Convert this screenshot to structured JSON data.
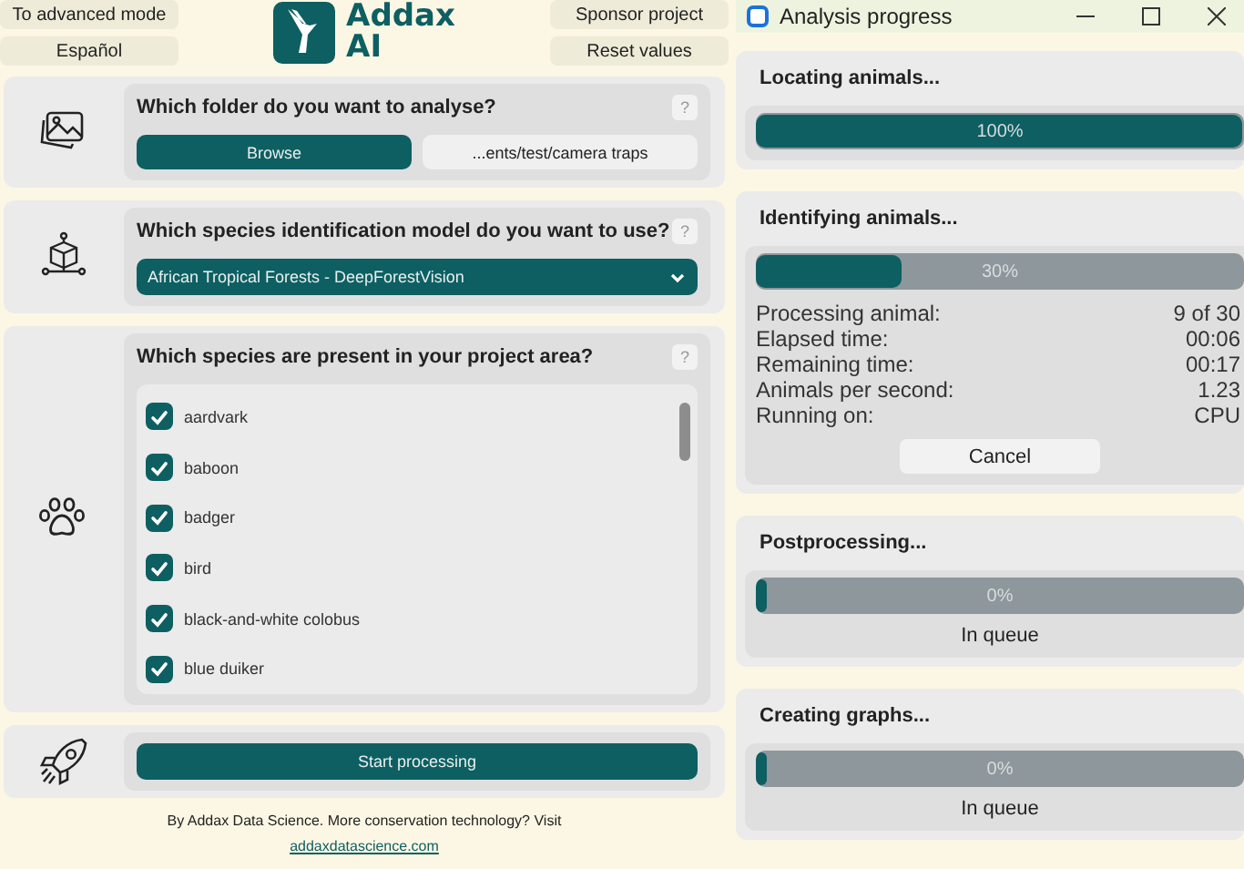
{
  "header": {
    "left_buttons": [
      "To advanced mode",
      "Español"
    ],
    "logo_text": [
      "Addax",
      "AI"
    ],
    "right_buttons": [
      "Sponsor project",
      "Reset values"
    ]
  },
  "steps": [
    {
      "kind": "folder",
      "question": "Which folder do you want to analyse?",
      "help": "?",
      "browse": "Browse",
      "path": "...ents/test/camera traps"
    },
    {
      "kind": "model",
      "question": "Which species identification model do you want to use?",
      "help": "?",
      "selected_model": "African Tropical Forests - DeepForestVision"
    },
    {
      "kind": "species",
      "question": "Which species are present in your project area?",
      "help": "?",
      "species": [
        {
          "name": "aardvark",
          "checked": true
        },
        {
          "name": "baboon",
          "checked": true
        },
        {
          "name": "badger",
          "checked": true
        },
        {
          "name": "bird",
          "checked": true
        },
        {
          "name": "black-and-white colobus",
          "checked": true
        },
        {
          "name": "blue duiker",
          "checked": true
        }
      ]
    },
    {
      "kind": "start",
      "button": "Start processing"
    }
  ],
  "footer": {
    "text": "By Addax Data Science. More conservation technology? Visit",
    "link": "addaxdatascience.com"
  },
  "progress_window": {
    "title": "Analysis progress",
    "stages": [
      {
        "title": "Locating animals...",
        "level": 1,
        "percent": "100%"
      },
      {
        "title": "Identifying animals...",
        "level": 0.3,
        "percent": "30%",
        "details": [
          {
            "label": "Processing animal:",
            "value": "9 of 30"
          },
          {
            "label": "Elapsed time:",
            "value": "00:06"
          },
          {
            "label": "Remaining time:",
            "value": "00:17"
          },
          {
            "label": "Animals per second:",
            "value": "1.23"
          },
          {
            "label": "Running on:",
            "value": "CPU"
          }
        ],
        "cancel": "Cancel"
      },
      {
        "title": "Postprocessing...",
        "level": 0,
        "percent": "0%",
        "status": "In queue"
      },
      {
        "title": "Creating graphs...",
        "level": 0,
        "percent": "0%",
        "status": "In queue"
      }
    ]
  }
}
